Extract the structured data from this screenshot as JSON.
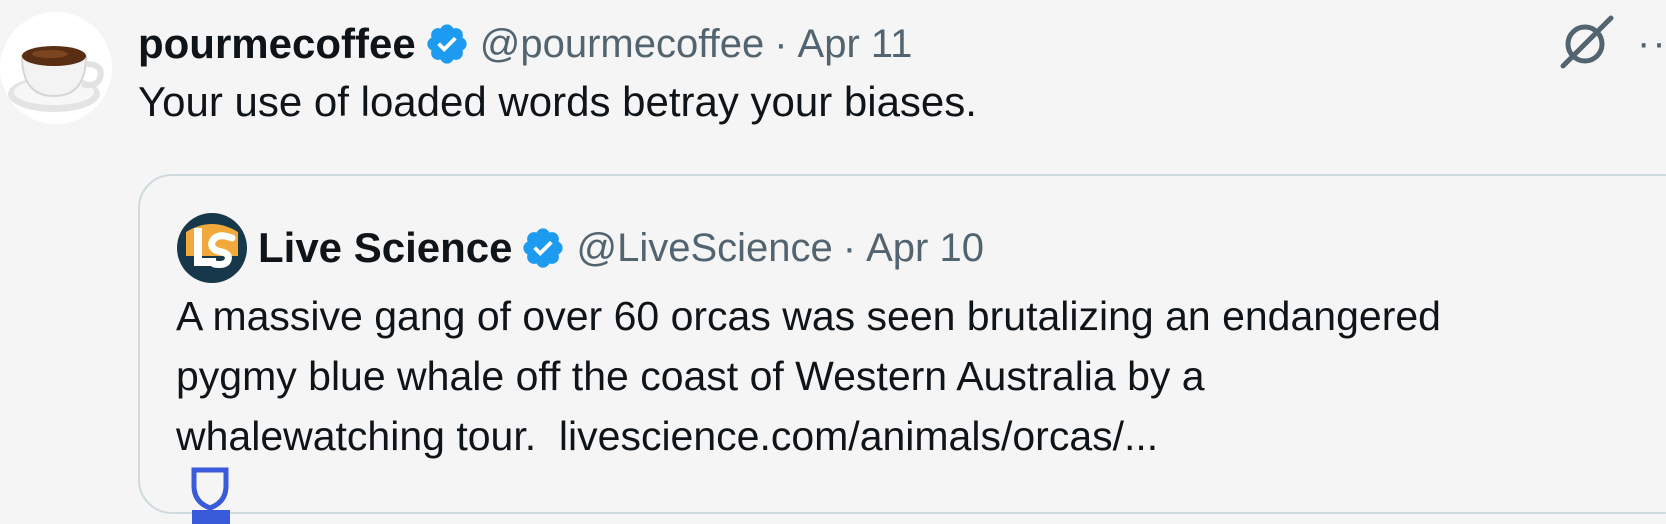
{
  "tweet": {
    "author_name": "pourmecoffee",
    "handle": "@pourmecoffee",
    "separator": "·",
    "date": "Apr 11",
    "text": "Your use of loaded words betray your biases.",
    "more_label": "··"
  },
  "quoted_tweet": {
    "author_name": "Live Science",
    "handle": "@LiveScience",
    "separator": "·",
    "date": "Apr 10",
    "text_lines": [
      "A massive gang of over 60 orcas was seen brutalizing an endangered",
      "pygmy blue whale off the coast of Western Australia by a",
      "whalewatching tour."
    ],
    "link_text": "livescience.com/animals/orcas/...",
    "badge_label": "?"
  },
  "colors": {
    "verified": "#1d9bf0",
    "muted_text": "#536471",
    "primary_text": "#0f1419",
    "border": "#cfd9de",
    "badge_blue": "#3a5bd9"
  },
  "icons": {
    "avatar": "coffee-cup-avatar",
    "verified": "verified-badge-icon",
    "grok": "grok-icon",
    "more": "more-icon",
    "quoted_avatar": "live-science-logo",
    "shield": "shield-icon"
  }
}
